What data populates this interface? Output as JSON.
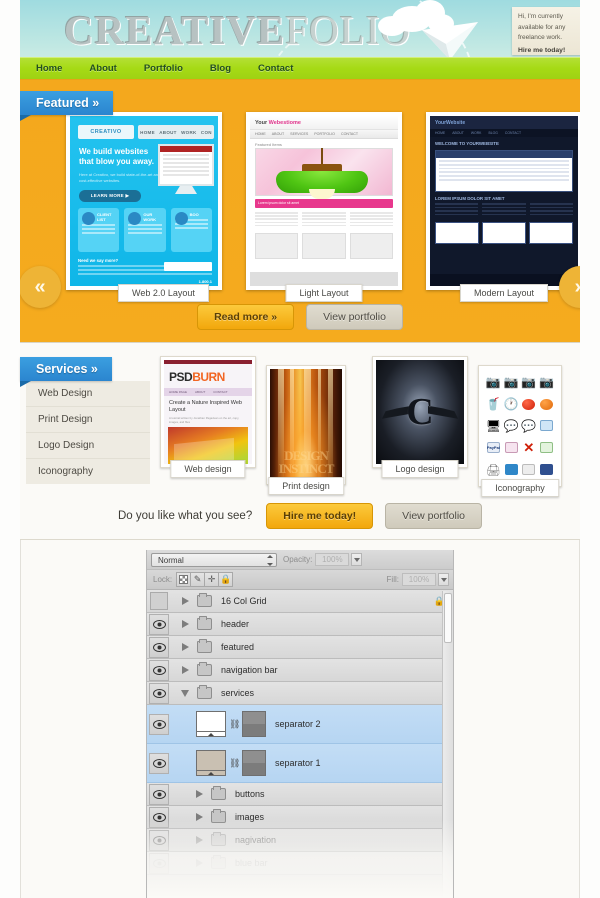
{
  "header": {
    "logo_bold": "CREATIVE",
    "logo_light": "FOLIO",
    "note_line1": "Hi, I'm currently",
    "note_line2": "available for any",
    "note_line3": "freelance work.",
    "note_cta": "Hire me today!",
    "sky_color": "#b6e4e2"
  },
  "nav": {
    "items": [
      {
        "label": "Home"
      },
      {
        "label": "About"
      },
      {
        "label": "Portfolio"
      },
      {
        "label": "Blog"
      },
      {
        "label": "Contact"
      }
    ],
    "bg_color": "#a6da15",
    "text_color": "#245020"
  },
  "featured": {
    "ribbon_label": "Featured »",
    "bg_color": "#f4a81d",
    "prev_arrow": "«",
    "next_arrow": "»",
    "slides": [
      {
        "caption": "Web 2.0 Layout",
        "logo": "CREATIVO",
        "menu": [
          "HOME",
          "ABOUT",
          "WORK",
          "CON"
        ],
        "headline": "We build websites that blow you away.",
        "subtext": "Here at Creativo, we build state-of-the-art and cost-effective websites.",
        "button": "LEARN MORE ▶",
        "cards": [
          "CLIENT LIST",
          "OUR WORK",
          "BOO"
        ],
        "footer_title": "Need we say more?",
        "phone": "1.800.1"
      },
      {
        "caption": "Light Layout",
        "logo_prefix": "Your ",
        "logo_accent": "Webestiome",
        "menu": [
          "HOME",
          "ABOUT",
          "SERVICES",
          "PORTFOLIO",
          "CONTACT"
        ],
        "section_label": "Featured Items",
        "banner_text": "Lorem ipsum dolor sit amet"
      },
      {
        "caption": "Modern Layout",
        "logo": "YourWebsite",
        "menu": [
          "HOME",
          "ABOUT",
          "WORK",
          "BLOG",
          "CONTACT"
        ],
        "hero_title": "WELCOME TO YOURWEBSITE",
        "section_title": "LOREM IPSUM DOLOR SIT AMET"
      }
    ],
    "actions": [
      {
        "label": "Read more »",
        "style": "amber"
      },
      {
        "label": "View portfolio",
        "style": "grey"
      }
    ]
  },
  "services": {
    "ribbon_label": "Services »",
    "items": [
      {
        "label": "Web Design"
      },
      {
        "label": "Print Design"
      },
      {
        "label": "Logo Design"
      },
      {
        "label": "Iconography"
      }
    ],
    "thumbs": [
      {
        "caption": "Web design",
        "logo": "PSD",
        "logo_accent": "BURN",
        "nav": [
          "HOME PAGE",
          "ABOUT",
          "CONTACT"
        ],
        "title": "Create a Nature Inspired Web Layout",
        "meta": "A tutorial written by Jonathan Pagaduan on the art, copy, images, and files"
      },
      {
        "caption": "Print design",
        "poster_text": "DESIGN INSTINCT"
      },
      {
        "caption": "Logo design",
        "mark": "C"
      },
      {
        "caption": "Iconography"
      }
    ],
    "question": "Do you like what you see?",
    "actions": [
      {
        "label": "Hire me today!",
        "style": "amber"
      },
      {
        "label": "View portfolio",
        "style": "grey"
      }
    ]
  },
  "photoshop": {
    "blend_mode": "Normal",
    "opacity_label": "Opacity:",
    "opacity_value": "100%",
    "lock_label": "Lock:",
    "fill_label": "Fill:",
    "fill_value": "100%",
    "lock_buttons": [
      "lock-transparent-pixels",
      "lock-image-pixels",
      "lock-position",
      "lock-all"
    ],
    "layers": [
      {
        "name": "16 Col Grid",
        "type": "group",
        "visible": false,
        "expanded": false,
        "locked": true,
        "selected": false,
        "dim": false
      },
      {
        "name": "header",
        "type": "group",
        "visible": true,
        "expanded": false,
        "locked": false,
        "selected": false,
        "dim": false
      },
      {
        "name": "featured",
        "type": "group",
        "visible": true,
        "expanded": false,
        "locked": false,
        "selected": false,
        "dim": false
      },
      {
        "name": "navigation bar",
        "type": "group",
        "visible": true,
        "expanded": false,
        "locked": false,
        "selected": false,
        "dim": false
      },
      {
        "name": "services",
        "type": "group",
        "visible": true,
        "expanded": true,
        "locked": false,
        "selected": false,
        "dim": false
      },
      {
        "name": "separator 2",
        "type": "layer",
        "visible": true,
        "selected": true,
        "thumb": "#ffffff",
        "dim": false
      },
      {
        "name": "separator 1",
        "type": "layer",
        "visible": true,
        "selected": true,
        "thumb": "#c9c0b2",
        "dim": false
      },
      {
        "name": "buttons",
        "type": "group",
        "visible": true,
        "expanded": false,
        "locked": false,
        "selected": false,
        "dim": false
      },
      {
        "name": "images",
        "type": "group",
        "visible": true,
        "expanded": false,
        "locked": false,
        "selected": false,
        "dim": false
      },
      {
        "name": "nagivation",
        "type": "group",
        "visible": true,
        "expanded": false,
        "locked": false,
        "selected": false,
        "dim": true
      },
      {
        "name": "blue bar",
        "type": "group",
        "visible": true,
        "expanded": false,
        "locked": false,
        "selected": false,
        "dim": true
      }
    ]
  }
}
